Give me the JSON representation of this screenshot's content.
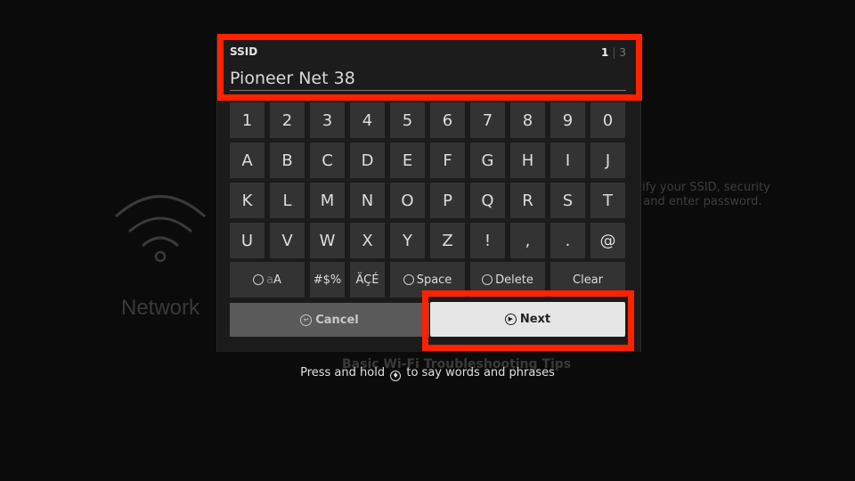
{
  "background": {
    "network_label": "Network",
    "description_line1": "ecify your SSID, security",
    "description_line2": "e, and enter password.",
    "tips_label": "Basic Wi-Fi Troubleshooting Tips"
  },
  "field": {
    "label": "SSID",
    "value": "Pioneer Net 38",
    "step_current": "1",
    "step_total": "3"
  },
  "keyboard": {
    "rows": [
      [
        "1",
        "2",
        "3",
        "4",
        "5",
        "6",
        "7",
        "8",
        "9",
        "0"
      ],
      [
        "A",
        "B",
        "C",
        "D",
        "E",
        "F",
        "G",
        "H",
        "I",
        "J"
      ],
      [
        "K",
        "L",
        "M",
        "N",
        "O",
        "P",
        "Q",
        "R",
        "S",
        "T"
      ],
      [
        "U",
        "V",
        "W",
        "X",
        "Y",
        "Z",
        "!",
        ",",
        ".",
        "@"
      ]
    ],
    "function_keys": {
      "case_label": "A",
      "case_faint": "a",
      "symbols": "#$%",
      "accents": "ÄÇÉ",
      "space": "Space",
      "delete": "Delete",
      "clear": "Clear"
    }
  },
  "buttons": {
    "cancel": "Cancel",
    "next": "Next"
  },
  "hint": {
    "before": "Press and hold",
    "after": "to say words and phrases"
  },
  "colors": {
    "highlight": "#ff2200"
  }
}
